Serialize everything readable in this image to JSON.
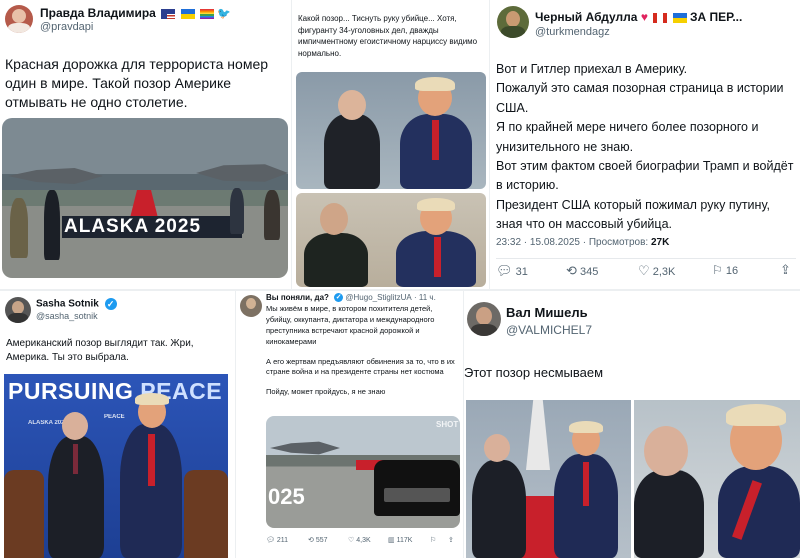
{
  "t1": {
    "name": "Правда Владимира",
    "handle": "@pravdapi",
    "text": "Красная дорожка для террориста номер один в мире. Такой позор Америке отмывать не одно столетие.",
    "sign_text": "ALASKA 2025"
  },
  "t2": {
    "text": "Какой позор... Тиснуть руку убийце... Хотя, фигуранту 34-уголовных дел, дважды импичментному егоистичному нарциссу видимо нормально."
  },
  "t3": {
    "name": "Черный Абдулла",
    "name_suffix": "ЗА ПЕР...",
    "handle": "@turkmendagz",
    "lines": [
      "Вот и Гитлер приехал в Америку.",
      "Пожалуй это самая позорная страница в истории США.",
      "Я  по крайней мере ничего более позорного и унизительного не знаю.",
      "Вот этим фактом своей биографии Трамп и войдёт в историю.",
      "Президент США который пожимал руку путину, зная что он массовый убийца."
    ],
    "meta": "23:32 · 15.08.2025 · Просмотров:",
    "views": "27K",
    "stats": {
      "replies": "31",
      "reposts": "345",
      "likes": "2,3K",
      "bookmarks": "16"
    }
  },
  "t4": {
    "name": "Sasha Sotnik",
    "handle": "@sasha_sotnik",
    "text": "Американский позор выглядит так. Жри, Америка. Ты это выбрала.",
    "banner_a": "PURSUING",
    "banner_b": "PEACE",
    "small_label": "ALASKA 2025",
    "podium": "PEACE"
  },
  "t5": {
    "name": "Вы поняли, да?",
    "mention": "@Hugo_StiglitzUA",
    "time": "· 11 ч.",
    "p1": "Мы живём в мире, в котором похитителя детей, убийцу, оккупанта, диктатора и международного преступника встречают красной дорожкой и кинокамерами",
    "p2": "А его жертвам предъявляют обвинения за то, что в их стране война и на президенте страны нет костюма",
    "p3": "Пойду, может пройдусь, я не знаю",
    "photo_text": "025",
    "watermark": "SHOT",
    "stats": {
      "replies": "211",
      "reposts": "557",
      "likes": "4,3K",
      "views": "117K"
    }
  },
  "t6": {
    "name": "Вал Мишель",
    "handle": "@VALMICHEL7",
    "text": "Этот позор несмываем"
  },
  "colors": {
    "blue": "#1d9bf0",
    "red_carpet": "#c8202b",
    "navy": "#1f2a55"
  }
}
